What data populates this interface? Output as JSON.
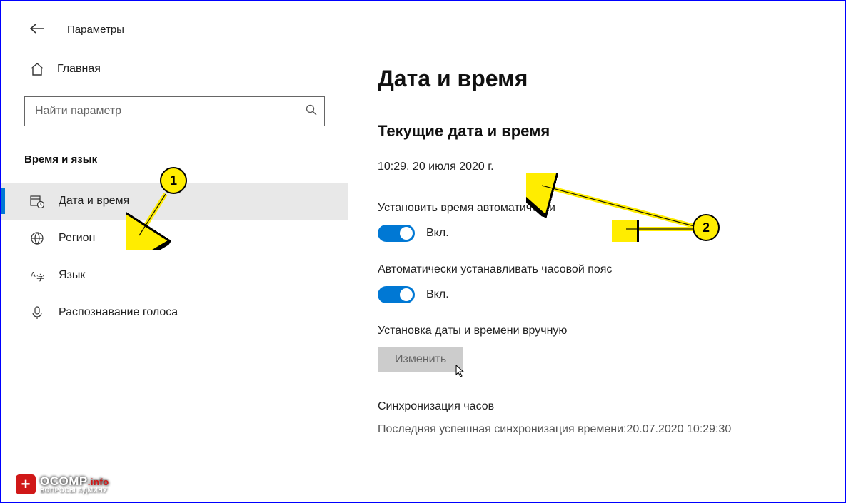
{
  "header": {
    "title": "Параметры"
  },
  "sidebar": {
    "home_label": "Главная",
    "search_placeholder": "Найти параметр",
    "category_title": "Время и язык",
    "items": [
      {
        "label": "Дата и время",
        "icon": "calendar-clock-icon"
      },
      {
        "label": "Регион",
        "icon": "globe-icon"
      },
      {
        "label": "Язык",
        "icon": "language-icon"
      },
      {
        "label": "Распознавание голоса",
        "icon": "microphone-icon"
      }
    ]
  },
  "main": {
    "heading": "Дата и время",
    "section_current": "Текущие дата и время",
    "current_datetime": "10:29, 20 июля 2020 г.",
    "auto_time_label": "Установить время автоматически",
    "auto_time_state": "Вкл.",
    "auto_tz_label": "Автоматически устанавливать часовой пояс",
    "auto_tz_state": "Вкл.",
    "manual_label": "Установка даты и времени вручную",
    "change_button": "Изменить",
    "sync_title": "Синхронизация часов",
    "sync_text": "Последняя успешная синхронизация времени:20.07.2020 10:29:30"
  },
  "annotations": {
    "badge1": "1",
    "badge2": "2"
  },
  "watermark": {
    "main": "OCOMP",
    "suffix": ".info",
    "sub": "ВОПРОСЫ АДМИНУ"
  }
}
